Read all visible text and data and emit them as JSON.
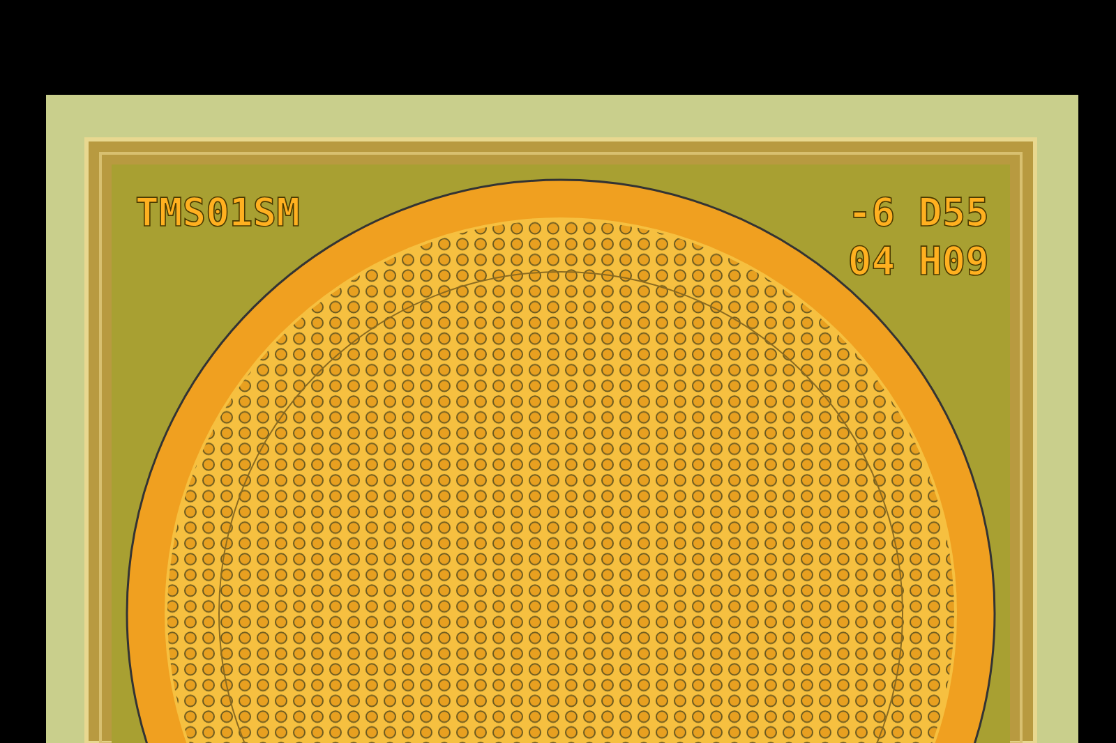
{
  "die": {
    "kind": "chip-die",
    "left_markings": [
      "TMS01SM"
    ],
    "right_markings": [
      "-6 D55",
      "04 H09"
    ]
  }
}
